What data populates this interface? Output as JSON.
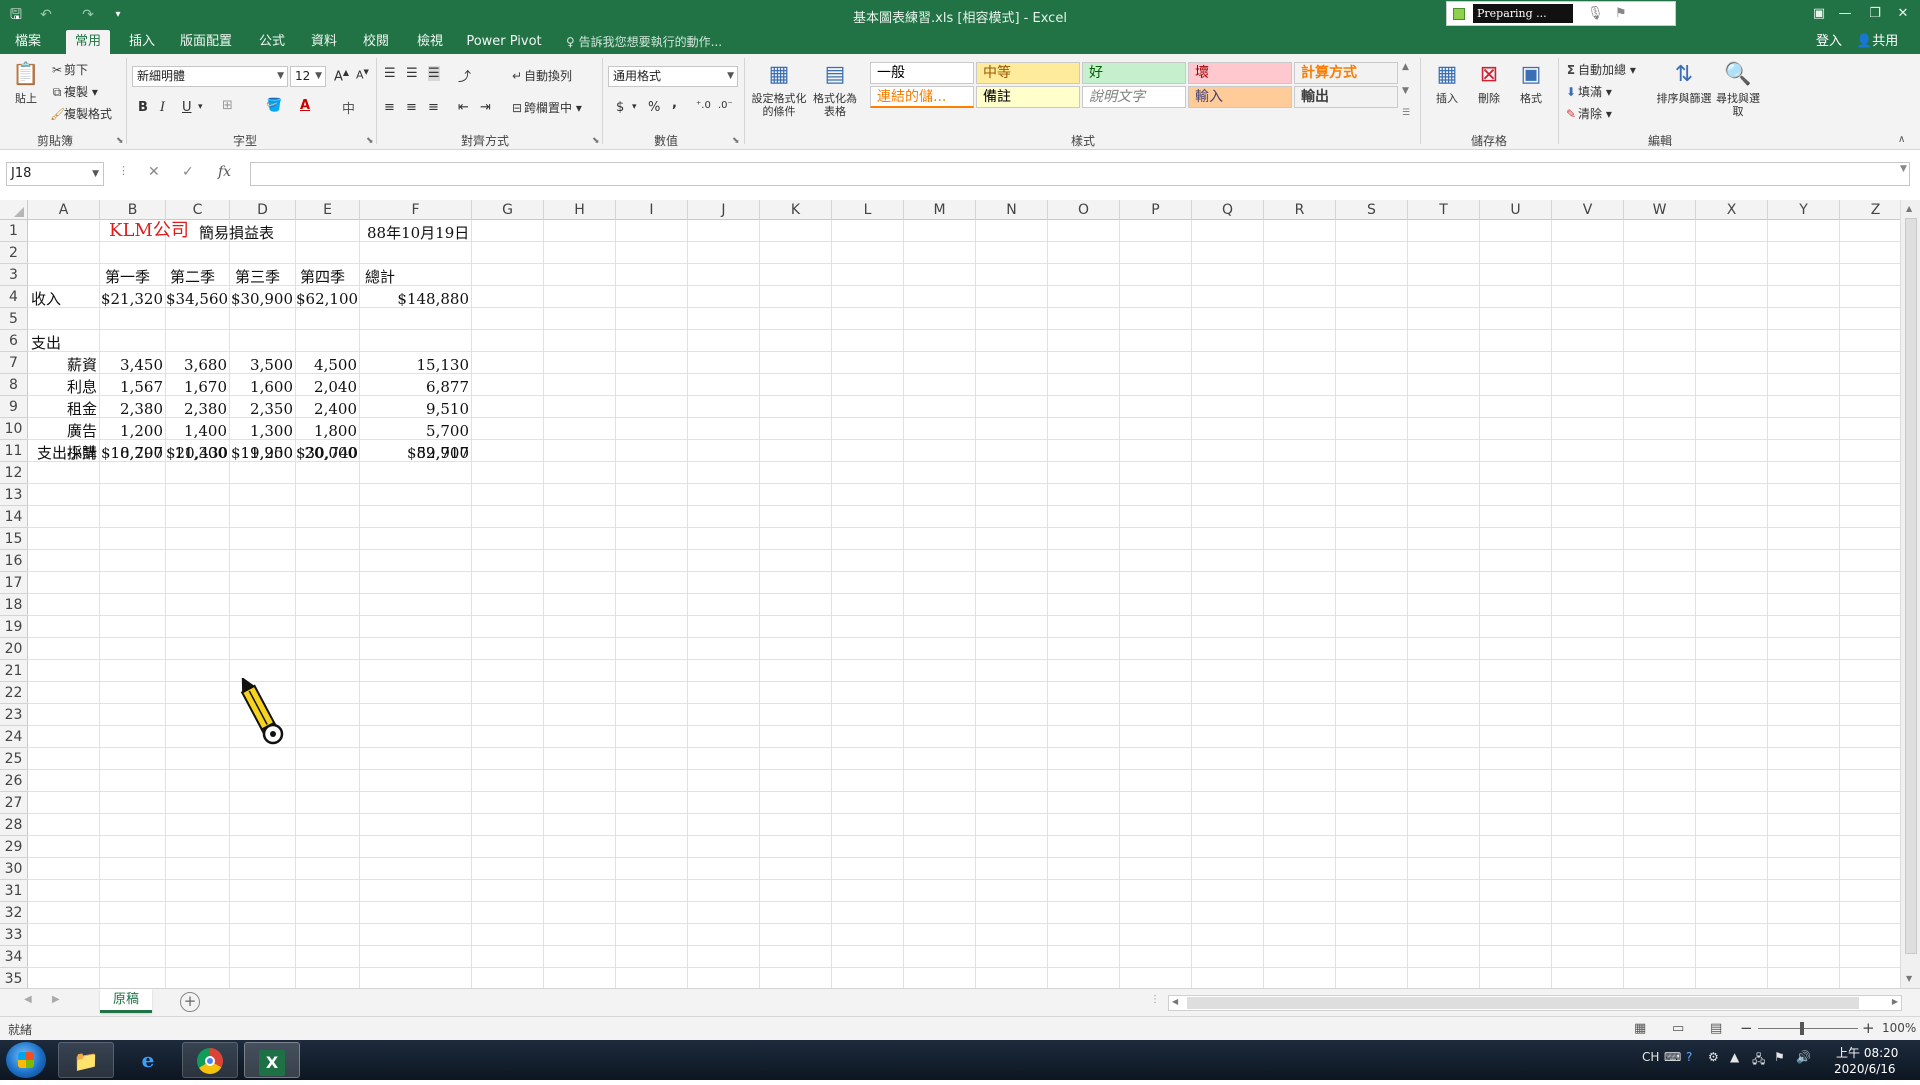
{
  "titlebar": {
    "title": "基本圖表練習.xls  [相容模式] - Excel",
    "preparing": "Preparing ..."
  },
  "tabs": [
    {
      "label": "檔案",
      "active": false
    },
    {
      "label": "常用",
      "active": true
    },
    {
      "label": "插入",
      "active": false
    },
    {
      "label": "版面配置",
      "active": false
    },
    {
      "label": "公式",
      "active": false
    },
    {
      "label": "資料",
      "active": false
    },
    {
      "label": "校閱",
      "active": false
    },
    {
      "label": "檢視",
      "active": false
    },
    {
      "label": "Power Pivot",
      "active": false
    }
  ],
  "tellme": "告訴我您想要執行的動作...",
  "signin": "登入",
  "share": "共用",
  "ribbon": {
    "clipboard": {
      "paste": "貼上",
      "cut": "剪下",
      "copy": "複製",
      "format_painter": "複製格式",
      "label": "剪貼簿"
    },
    "font": {
      "name": "新細明體",
      "size": "12",
      "label": "字型",
      "bold": "B",
      "italic": "I",
      "underline": "U"
    },
    "alignment": {
      "wrap": "自動換列",
      "merge": "跨欄置中",
      "label": "對齊方式"
    },
    "number": {
      "format": "通用格式",
      "currency": "$",
      "percent": "%",
      "comma": ",",
      "label": "數值"
    },
    "styles": {
      "conditional": "設定格式化的條件",
      "as_table": "格式化為表格",
      "cells": [
        {
          "text": "一般",
          "bg": "#ffffff",
          "fg": "#000000"
        },
        {
          "text": "中等",
          "bg": "#ffeb9c",
          "fg": "#9c5700"
        },
        {
          "text": "好",
          "bg": "#c6efce",
          "fg": "#006100"
        },
        {
          "text": "壞",
          "bg": "#ffc7ce",
          "fg": "#9c0006"
        },
        {
          "text": "計算方式",
          "bg": "#f2f2f2",
          "fg": "#fa7d00"
        },
        {
          "text": "連結的儲...",
          "bg": "#ffffff",
          "fg": "#fa7d00"
        },
        {
          "text": "備註",
          "bg": "#ffffcc",
          "fg": "#000000"
        },
        {
          "text": "說明文字",
          "bg": "#ffffff",
          "fg": "#7f7f7f"
        },
        {
          "text": "輸入",
          "bg": "#ffcc99",
          "fg": "#3f3f76"
        },
        {
          "text": "輸出",
          "bg": "#f2f2f2",
          "fg": "#3f3f3f"
        }
      ],
      "label": "樣式"
    },
    "cells_group": {
      "insert": "插入",
      "delete": "刪除",
      "format": "格式",
      "label": "儲存格"
    },
    "editing": {
      "autosum": "自動加總",
      "fill": "填滿",
      "clear": "清除",
      "sort": "排序與篩選",
      "find": "尋找與選取",
      "label": "編輯"
    }
  },
  "formula": {
    "namebox": "J18",
    "fx": "fx",
    "value": ""
  },
  "columns": [
    "A",
    "B",
    "C",
    "D",
    "E",
    "F",
    "G",
    "H",
    "I",
    "J",
    "K",
    "L",
    "M",
    "N",
    "O",
    "P",
    "Q",
    "R",
    "S",
    "T",
    "U",
    "V",
    "W",
    "X",
    "Y",
    "Z"
  ],
  "rows": [
    "1",
    "2",
    "3",
    "4",
    "5",
    "6",
    "7",
    "8",
    "9",
    "10",
    "11",
    "12",
    "13",
    "14",
    "15",
    "16",
    "17",
    "18",
    "19",
    "20",
    "21",
    "22",
    "23",
    "24",
    "25",
    "26",
    "27",
    "28",
    "29",
    "30",
    "31",
    "32",
    "33",
    "34",
    "35"
  ],
  "sheet": {
    "title_red": "KLM公司",
    "title_rest": "簡易損益表",
    "date": "88年10月19日",
    "headers": [
      "第一季",
      "第二季",
      "第三季",
      "第四季",
      "總計"
    ],
    "income_label": "收入",
    "income": [
      "$21,320",
      "$34,560",
      "$30,900",
      "$62,100",
      "$148,880"
    ],
    "expense_label": "支出",
    "expenses": [
      {
        "label": "薪資",
        "values": [
          "3,450",
          "3,680",
          "3,500",
          "4,500",
          "15,130"
        ]
      },
      {
        "label": "利息",
        "values": [
          "1,567",
          "1,670",
          "1,600",
          "2,040",
          "6,877"
        ]
      },
      {
        "label": "租金",
        "values": [
          "2,380",
          "2,380",
          "2,350",
          "2,400",
          "9,510"
        ]
      },
      {
        "label": "廣告",
        "values": [
          "1,200",
          "1,400",
          "1,300",
          "1,800",
          "5,700"
        ]
      },
      {
        "label": "採購",
        "values": [
          "10,200",
          "11,300",
          "11,200",
          "20,000",
          "52,700"
        ]
      }
    ],
    "subtotal_label": "支出小計",
    "subtotal": [
      "$18,797",
      "$20,430",
      "$19,950",
      "$30,740",
      "$89,917"
    ]
  },
  "sheet_tab": "原稿",
  "status": {
    "text": "就緒",
    "zoom": "100%"
  },
  "taskbar": {
    "tray_lang": "CH",
    "time": "上午 08:20",
    "date": "2020/6/16"
  }
}
